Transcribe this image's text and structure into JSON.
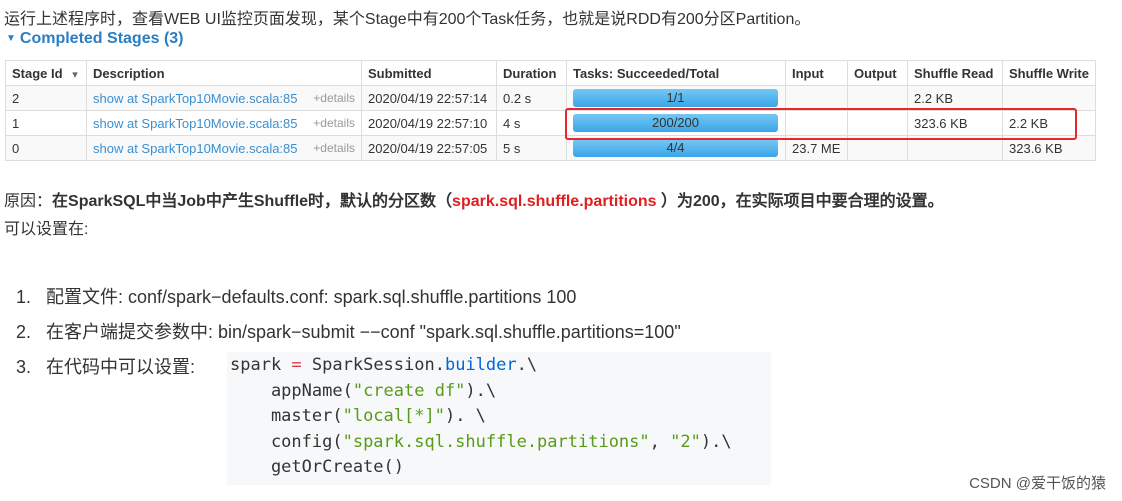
{
  "intro": "运行上述程序时，查看WEB UI监控页面发现，某个Stage中有200个Task任务，也就是说RDD有200分区Partition。",
  "stages": {
    "title": "Completed Stages (3)",
    "columns": [
      "Stage Id",
      "Description",
      "Submitted",
      "Duration",
      "Tasks: Succeeded/Total",
      "Input",
      "Output",
      "Shuffle Read",
      "Shuffle Write"
    ],
    "sort_indicator": "▾",
    "rows": [
      {
        "id": "2",
        "desc": "show at SparkTop10Movie.scala:85",
        "details": "+details",
        "submitted": "2020/04/19 22:57:14",
        "duration": "0.2 s",
        "tasks": "1/1",
        "input": "",
        "output": "",
        "shuffle_read": "2.2 KB",
        "shuffle_write": ""
      },
      {
        "id": "1",
        "desc": "show at SparkTop10Movie.scala:85",
        "details": "+details",
        "submitted": "2020/04/19 22:57:10",
        "duration": "4 s",
        "tasks": "200/200",
        "input": "",
        "output": "",
        "shuffle_read": "323.6 KB",
        "shuffle_write": "2.2 KB"
      },
      {
        "id": "0",
        "desc": "show at SparkTop10Movie.scala:85",
        "details": "+details",
        "submitted": "2020/04/19 22:57:05",
        "duration": "5 s",
        "tasks": "4/4",
        "input": "23.7 ME",
        "output": "",
        "shuffle_read": "",
        "shuffle_write": "323.6 KB"
      }
    ],
    "highlight_color": "#e8262b"
  },
  "reason": {
    "prefix": "原因：",
    "bold1": "在SparkSQL中当Job中产生Shuffle时，默认的分区数（",
    "param": "spark.sql.shuffle.partitions",
    "bold2": " ）为200，在实际项目中要合理的设置。",
    "line2": "可以设置在:"
  },
  "list": [
    {
      "n": "1.",
      "text": "配置文件: conf/spark−defaults.conf:     spark.sql.shuffle.partitions 100"
    },
    {
      "n": "2.",
      "text": "在客户端提交参数中: bin/spark−submit −−conf \"spark.sql.shuffle.partitions=100\""
    },
    {
      "n": "3.",
      "text": "在代码中可以设置: "
    }
  ],
  "code": {
    "l1a": "spark ",
    "l1op": "=",
    "l1b": " SparkSession.",
    "l1fn": "builder",
    "l1c": ".\\",
    "l2a": "    appName(",
    "l2s": "\"create df\"",
    "l2b": ").\\",
    "l3a": "    master(",
    "l3s": "\"local[*]\"",
    "l3b": "). \\",
    "l4a": "    config(",
    "l4s1": "\"spark.sql.shuffle.partitions\"",
    "l4m": ", ",
    "l4s2": "\"2\"",
    "l4b": ").\\",
    "l5": "    getOrCreate()"
  },
  "watermark": "CSDN @爱干饭的猿"
}
